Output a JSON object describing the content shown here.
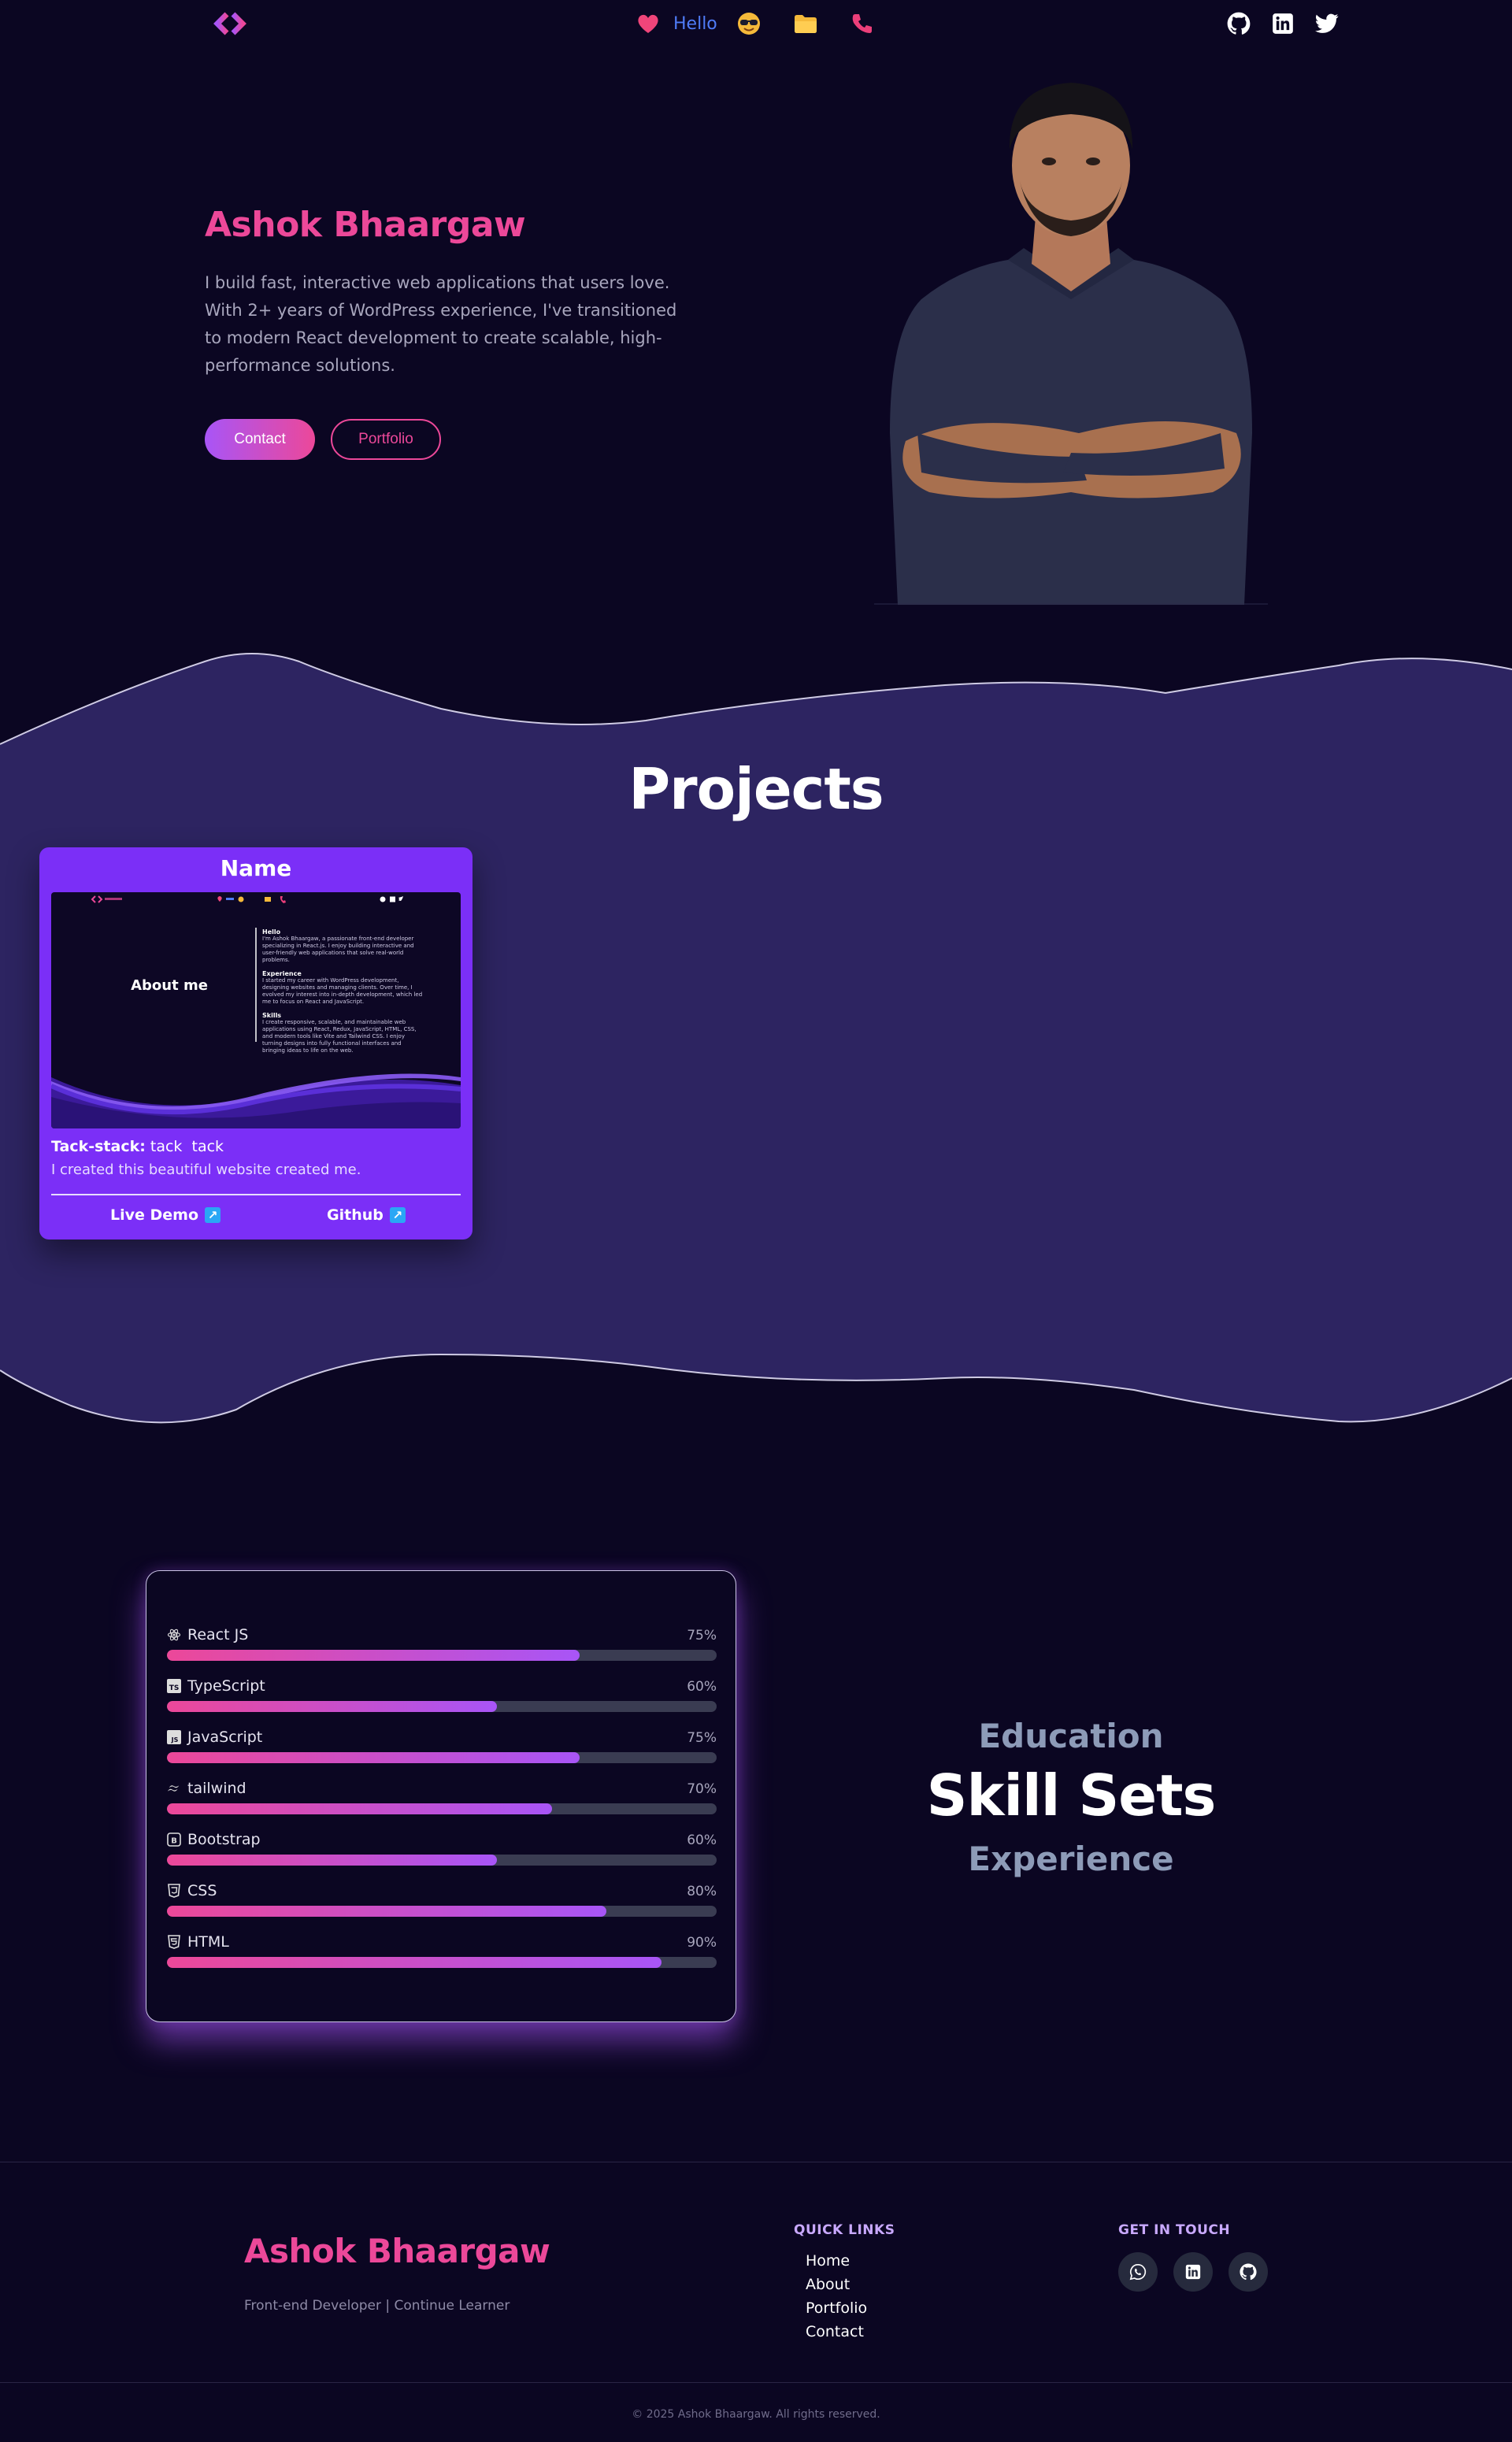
{
  "nav": {
    "hello_label": "Hello",
    "left_icon": "code-logo-icon",
    "center_icons": [
      "heart-icon",
      "sunglasses-emoji-icon",
      "folder-icon",
      "phone-icon"
    ],
    "right_icons": [
      "github-icon",
      "linkedin-icon",
      "twitter-icon"
    ]
  },
  "hero": {
    "name": "Ashok Bhaargaw",
    "description": "I build fast, interactive web applications that users love. With 2+ years of WordPress experience, I've transitioned to modern React development to create scalable, high-performance solutions.",
    "contact_label": "Contact",
    "portfolio_label": "Portfolio"
  },
  "projects": {
    "title": "Projects",
    "cards": [
      {
        "name": "Name",
        "stack_label": "Tack-stack:",
        "stack_items": "tack  tack",
        "description": "I created this beautiful website created me.",
        "live_label": "Live Demo",
        "github_label": "Github",
        "preview": {
          "heading": "About me",
          "sections": [
            {
              "title": "Hello",
              "text": "I'm Ashok Bhaargaw, a passionate front-end developer specializing in React.js. I enjoy building interactive and user-friendly web applications that solve real-world problems."
            },
            {
              "title": "Experience",
              "text": "I started my career with WordPress development, designing websites and managing clients. Over time, I evolved my interest into in-depth development, which led me to focus on React and JavaScript."
            },
            {
              "title": "Skills",
              "text": "I create responsive, scalable, and maintainable web applications using React, Redux, JavaScript, HTML, CSS, and modern tools like Vite and Tailwind CSS. I enjoy turning designs into fully functional interfaces and bringing ideas to life on the web."
            }
          ]
        }
      }
    ]
  },
  "skills": {
    "items": [
      {
        "name": "React JS",
        "percent_label": "75%",
        "value": 75,
        "icon": "react-icon"
      },
      {
        "name": "TypeScript",
        "percent_label": "60%",
        "value": 60,
        "icon": "typescript-icon"
      },
      {
        "name": "JavaScript",
        "percent_label": "75%",
        "value": 75,
        "icon": "javascript-icon"
      },
      {
        "name": "tailwind",
        "percent_label": "70%",
        "value": 70,
        "icon": "tailwind-icon"
      },
      {
        "name": "Bootstrap",
        "percent_label": "60%",
        "value": 60,
        "icon": "bootstrap-icon"
      },
      {
        "name": "CSS",
        "percent_label": "80%",
        "value": 80,
        "icon": "css3-icon"
      },
      {
        "name": "HTML",
        "percent_label": "90%",
        "value": 90,
        "icon": "html5-icon"
      }
    ],
    "tabs": {
      "education": "Education",
      "skill_sets": "Skill Sets",
      "experience": "Experience"
    }
  },
  "footer": {
    "name": "Ashok Bhaargaw",
    "tagline": "Front-end Developer | Continue Learner",
    "quick_links_title": "QUICK LINKS",
    "quick_links": [
      "Home",
      "About",
      "Portfolio",
      "Contact"
    ],
    "get_in_touch_title": "GET IN TOUCH",
    "social_icons": [
      "whatsapp-icon",
      "linkedin-icon",
      "github-icon"
    ],
    "copyright": "© 2025 Ashok Bhaargaw. All rights reserved."
  },
  "colors": {
    "background": "#0b0622",
    "band": "#2d2461",
    "accent_pink": "#ec4899",
    "accent_purple": "#a855f7",
    "card": "#7b2ff7",
    "hello_blue": "#4f7cf7"
  }
}
